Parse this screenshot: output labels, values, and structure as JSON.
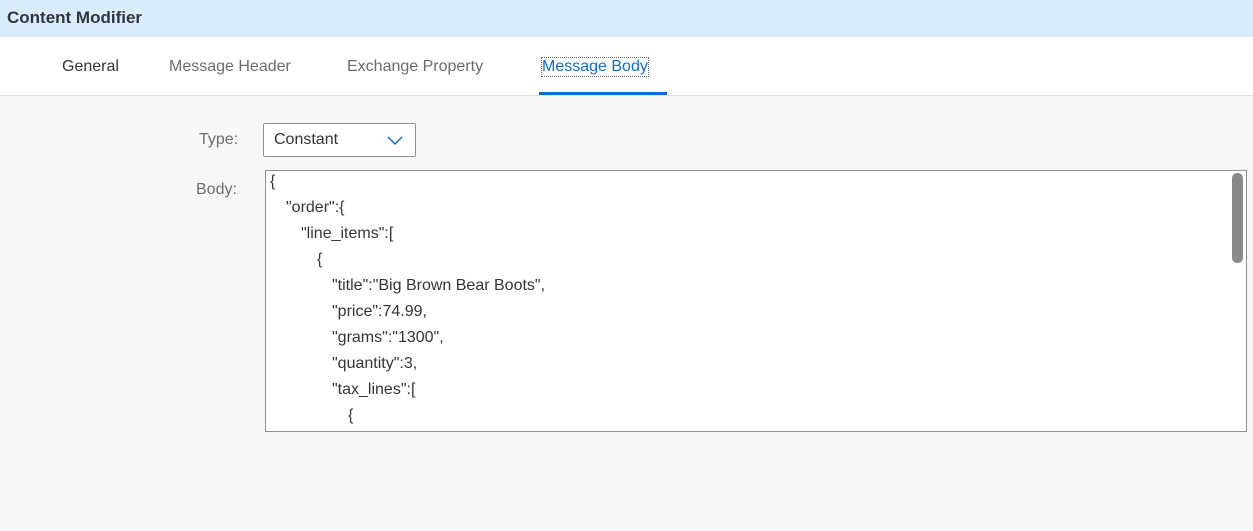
{
  "window": {
    "title": "Content Modifier"
  },
  "tabs": [
    {
      "label": "General",
      "active": false
    },
    {
      "label": "Message Header",
      "active": false
    },
    {
      "label": "Exchange Property",
      "active": false
    },
    {
      "label": "Message Body",
      "active": true
    }
  ],
  "form": {
    "type_label": "Type:",
    "type_value": "Constant",
    "body_label": "Body:"
  },
  "body_lines": [
    "{",
    "\"order\":{",
    "\"line_items\":[",
    "{",
    "\"title\":\"Big Brown Bear Boots\",",
    "\"price\":74.99,",
    "\"grams\":\"1300\",",
    "\"quantity\":3,",
    "\"tax_lines\":[",
    "{"
  ],
  "icons": {
    "dropdown": "chevron-down-icon"
  },
  "colors": {
    "title_bar": "#d9ecfb",
    "accent": "#0a6ed1",
    "background": "#f7f7f7"
  }
}
